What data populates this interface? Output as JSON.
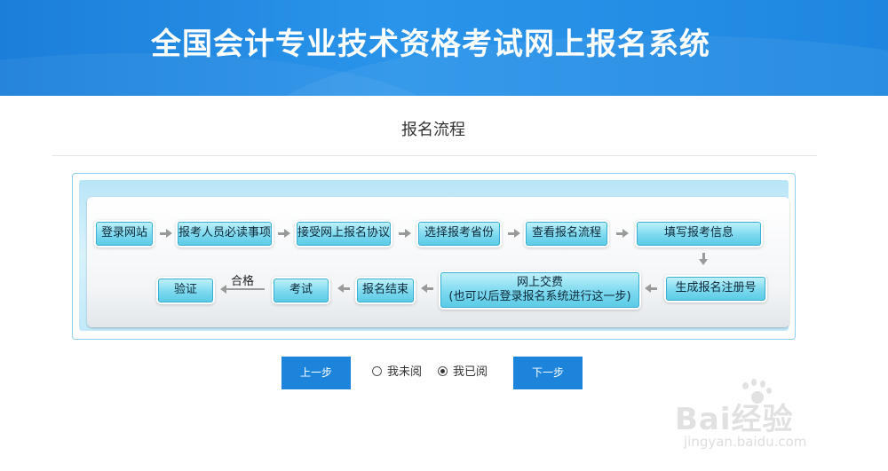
{
  "header": {
    "title": "全国会计专业技术资格考试网上报名系统"
  },
  "section": {
    "title": "报名流程"
  },
  "flow": {
    "row1": [
      "登录网站",
      "报考人员必读事项",
      "接受网上报名协议",
      "选择报考省份",
      "查看报名流程",
      "填写报考信息"
    ],
    "row2": {
      "register": "生成报名注册号",
      "pay_line1": "网上交费",
      "pay_line2": "(也可以后登录报名系统进行这一步)",
      "end": "报名结束",
      "exam": "考试",
      "pass_label": "合格",
      "verify": "验证"
    }
  },
  "controls": {
    "prev_label": "上一步",
    "unread_label": "我未阅",
    "read_label": "我已阅",
    "next_label": "下一步",
    "selected": "read"
  },
  "watermark": {
    "brand": "Bai经验",
    "url": "jingyan.baidu.com"
  }
}
